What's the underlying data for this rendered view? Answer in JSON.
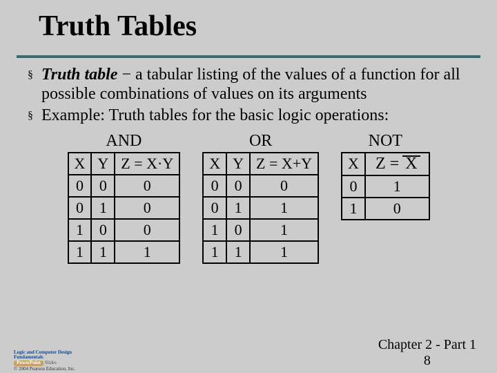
{
  "title": "Truth Tables",
  "bullets": {
    "b1_term": "Truth table",
    "b1_rest": " − a tabular listing of the values of a function for all possible combinations of values on its arguments",
    "b2": "Example: Truth tables for the basic logic operations:"
  },
  "tables": {
    "and": {
      "title": "AND",
      "h1": "X",
      "h2": "Y",
      "h3": "Z = X·Y",
      "rows": [
        [
          "0",
          "0",
          "0"
        ],
        [
          "0",
          "1",
          "0"
        ],
        [
          "1",
          "0",
          "0"
        ],
        [
          "1",
          "1",
          "1"
        ]
      ]
    },
    "or": {
      "title": "OR",
      "h1": "X",
      "h2": "Y",
      "h3": "Z = X+Y",
      "rows": [
        [
          "0",
          "0",
          "0"
        ],
        [
          "0",
          "1",
          "1"
        ],
        [
          "1",
          "0",
          "1"
        ],
        [
          "1",
          "1",
          "1"
        ]
      ]
    },
    "not": {
      "title": "NOT",
      "h1": "X",
      "z_prefix": "Z",
      "z_eq": "=",
      "z_x": "X",
      "rows": [
        [
          "0",
          "1"
        ],
        [
          "1",
          "0"
        ]
      ]
    }
  },
  "footer": {
    "right1": "Chapter 2 - Part 1",
    "right2": "8"
  },
  "logo": {
    "l1": "Logic and Computer Design Fundamentals",
    "l2a": "PowerPoint",
    "l2b": "Slides",
    "l3": "© 2004 Pearson Education, Inc."
  }
}
